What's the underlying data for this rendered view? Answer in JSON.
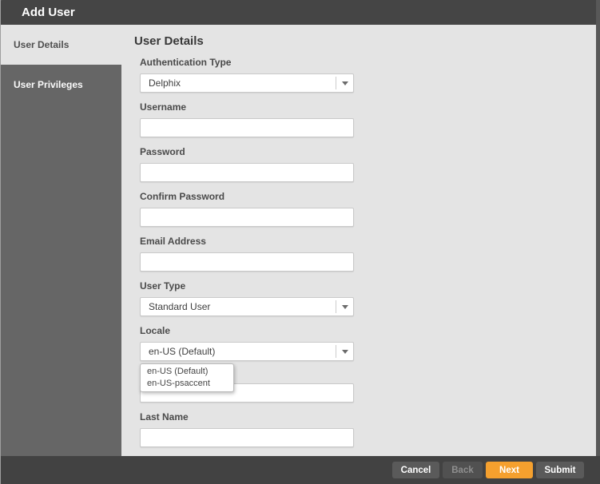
{
  "window": {
    "title": "Add User"
  },
  "sidebar": {
    "items": [
      {
        "label": "User Details",
        "active": true
      },
      {
        "label": "User Privileges",
        "active": false
      }
    ]
  },
  "content": {
    "heading": "User Details",
    "fields": [
      {
        "label": "Authentication Type",
        "type": "select",
        "value": "Delphix"
      },
      {
        "label": "Username",
        "type": "text",
        "value": ""
      },
      {
        "label": "Password",
        "type": "text",
        "value": ""
      },
      {
        "label": "Confirm Password",
        "type": "text",
        "value": ""
      },
      {
        "label": "Email Address",
        "type": "text",
        "value": ""
      },
      {
        "label": "User Type",
        "type": "select",
        "value": "Standard User"
      },
      {
        "label": "Locale",
        "type": "select",
        "value": "en-US (Default)"
      },
      {
        "label": "",
        "type": "text",
        "value": ""
      },
      {
        "label": "Last Name",
        "type": "text",
        "value": ""
      }
    ]
  },
  "locale_popup": {
    "options": [
      "en-US (Default)",
      "en-US-psaccent"
    ]
  },
  "footer": {
    "buttons": [
      {
        "label": "Cancel",
        "style": "gray",
        "enabled": true
      },
      {
        "label": "Back",
        "style": "gray",
        "enabled": false
      },
      {
        "label": "Next",
        "style": "orange",
        "enabled": true
      },
      {
        "label": "Submit",
        "style": "gray",
        "enabled": true
      }
    ]
  },
  "colors": {
    "header_bg": "#454545",
    "content_bg": "#e4e4e4",
    "sidebar_bg": "#666666",
    "footer_bg": "#424242",
    "accent_orange": "#f5a02e",
    "button_gray": "#5a5a5a"
  }
}
